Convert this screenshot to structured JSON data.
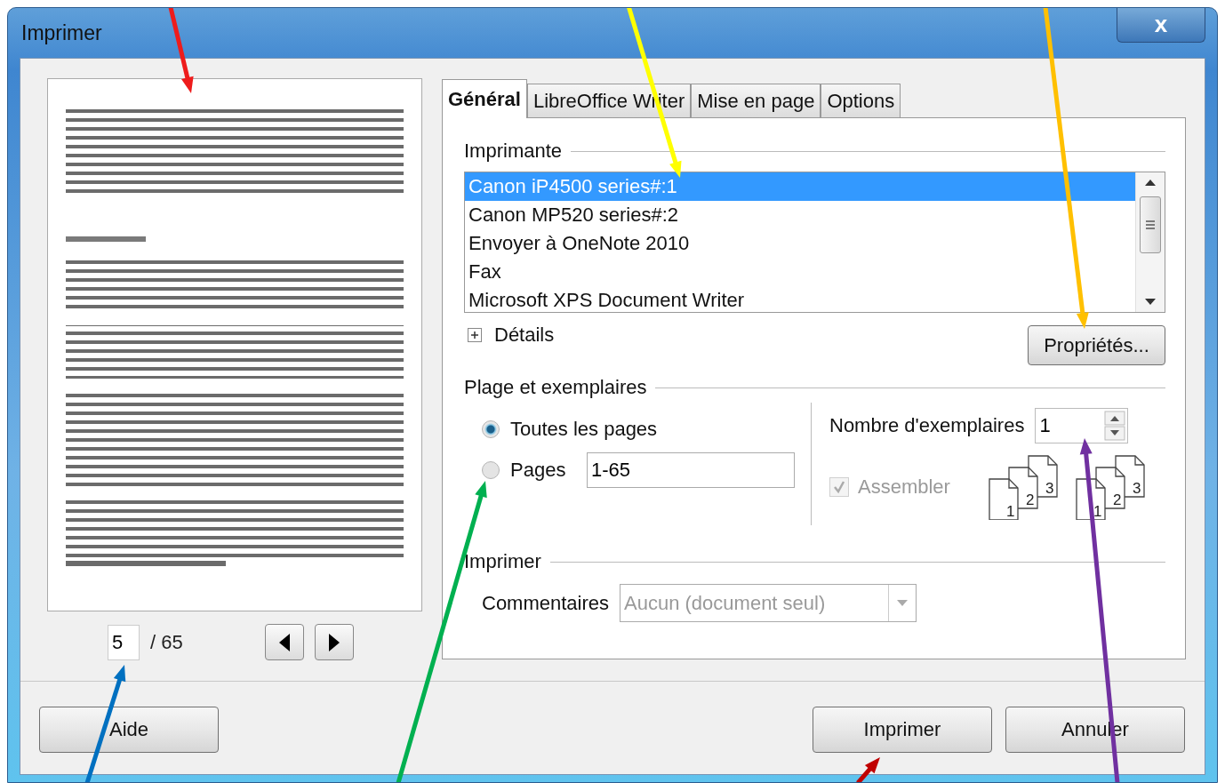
{
  "window": {
    "title": "Imprimer",
    "close": "x"
  },
  "preview": {
    "kind": "picture",
    "page": "5",
    "total": "/ 65"
  },
  "tabs": [
    {
      "label": "Général",
      "selected": true
    },
    {
      "label": "LibreOffice Writer",
      "selected": false
    },
    {
      "label": "Mise en page",
      "selected": false
    },
    {
      "label": "Options",
      "selected": false
    }
  ],
  "printer": {
    "heading": "Imprimante",
    "printers": [
      {
        "name": "Canon iP4500 series#:1",
        "selected": true
      },
      {
        "name": "Canon MP520 series#:2",
        "selected": false
      },
      {
        "name": "Envoyer à OneNote 2010",
        "selected": false
      },
      {
        "name": "Fax",
        "selected": false
      },
      {
        "name": "Microsoft XPS Document Writer",
        "selected": false
      }
    ],
    "details": "Détails",
    "details_expanded": false,
    "properties": "Propriétés..."
  },
  "range": {
    "heading": "Plage et exemplaires",
    "options": [
      {
        "label": "Toutes les pages",
        "selected": true
      },
      {
        "label": "Pages",
        "selected": false,
        "value": "1-65"
      }
    ],
    "copies_label": "Nombre d'exemplaires",
    "copies": "1",
    "collate": {
      "label": "Assembler",
      "checked": true,
      "disabled": true
    },
    "collate_icons": [
      [
        "1",
        "2",
        "3"
      ],
      [
        "1",
        "2",
        "3"
      ]
    ]
  },
  "print": {
    "heading": "Imprimer",
    "comments_label": "Commentaires",
    "comments": "Aucun (document seul)",
    "comments_disabled": true
  },
  "buttons": [
    {
      "label": "Aide"
    },
    {
      "label": "Imprimer"
    },
    {
      "label": "Annuler"
    }
  ],
  "annotations": [
    {
      "color": "#ee1c1c"
    },
    {
      "color": "#ffff00"
    },
    {
      "color": "#ffc000"
    },
    {
      "color": "#0070c0"
    },
    {
      "color": "#00b050"
    },
    {
      "color": "#c00000"
    },
    {
      "color": "#7030a0"
    }
  ]
}
